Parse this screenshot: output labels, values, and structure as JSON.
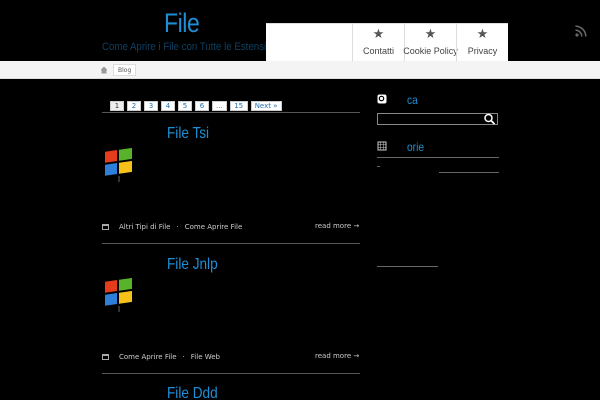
{
  "site": {
    "title": "File",
    "description": "Come Aprire i File con Tutte le Estensioni"
  },
  "nav": {
    "items": [
      {
        "label": "Contatti",
        "icon": "star-icon"
      },
      {
        "label": "Cookie Policy",
        "icon": "star-icon"
      },
      {
        "label": "Privacy",
        "icon": "star-icon"
      }
    ],
    "rss_icon": "rss-icon"
  },
  "breadcrumb": {
    "home_icon": "home-icon",
    "current": "Blog"
  },
  "pagination": {
    "pages": [
      "1",
      "2",
      "3",
      "4",
      "5",
      "6",
      "...",
      "15"
    ],
    "current": "1",
    "next_label": "Next »"
  },
  "posts": [
    {
      "title": "File Tsi",
      "categories": [
        "Altri Tipi di File",
        "Come Aprire File"
      ],
      "read_more": "read more →"
    },
    {
      "title": "File Jnlp",
      "categories": [
        "Come Aprire File",
        "File Web"
      ],
      "read_more": "read more →"
    },
    {
      "title": "File Ddd",
      "categories": [],
      "read_more": ""
    }
  ],
  "sidebar": {
    "search_title": "ca",
    "categories_title": "orie"
  },
  "colors": {
    "accent": "#1e8fd6",
    "background": "#000000",
    "nav_bg": "#ffffff"
  }
}
